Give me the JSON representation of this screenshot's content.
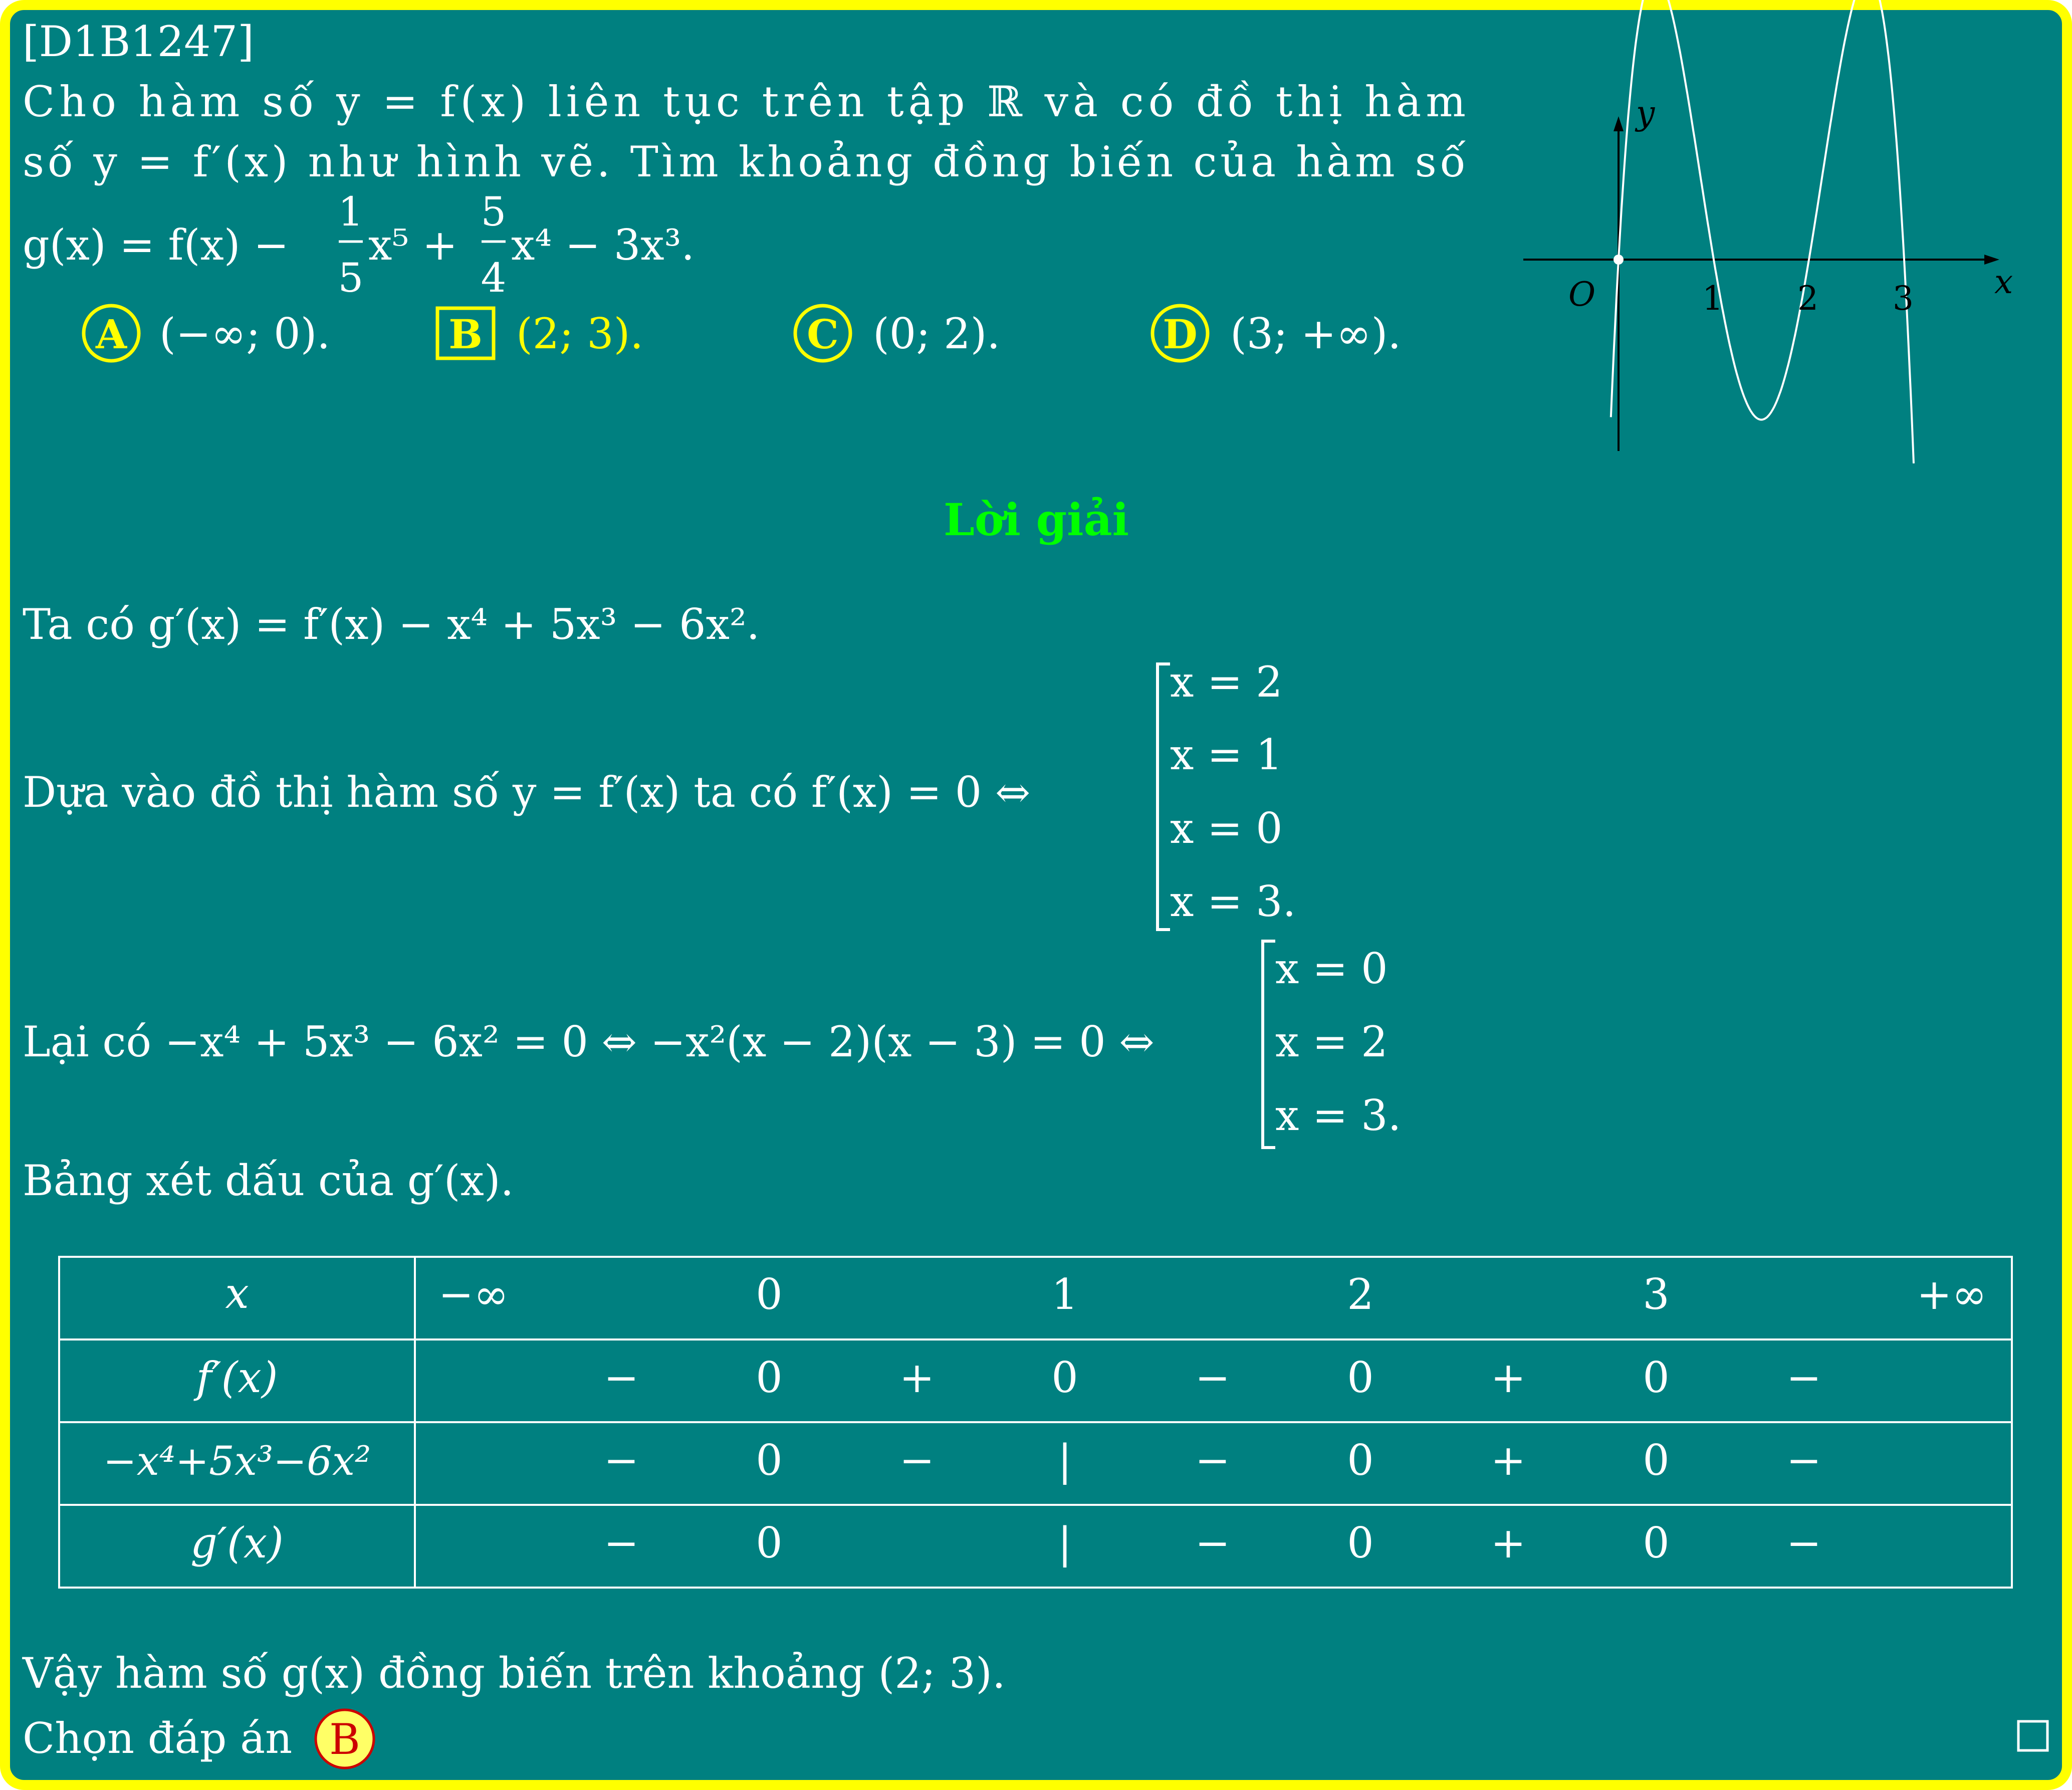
{
  "problem": {
    "id": "[D1B1247]",
    "text_line1": "Cho hàm số y = f(x) liên tục trên tập ℝ và có đồ thị hàm",
    "text_line2": "số y = f′(x) như hình vẽ. Tìm khoảng đồng biến của hàm số",
    "formula_head": "g(x) = f(x) −",
    "frac1": {
      "num": "1",
      "den": "5"
    },
    "term1": "x⁵ +",
    "frac2": {
      "num": "5",
      "den": "4"
    },
    "term2": "x⁴ − 3x³."
  },
  "options": [
    {
      "letter": "A",
      "text": "(−∞; 0).",
      "correct": false
    },
    {
      "letter": "B",
      "text": "(2; 3).",
      "correct": true
    },
    {
      "letter": "C",
      "text": "(0; 2).",
      "correct": false
    },
    {
      "letter": "D",
      "text": "(3; +∞).",
      "correct": false
    }
  ],
  "graph": {
    "x_label": "x",
    "y_label": "y",
    "origin_label": "O",
    "ticks": [
      "1",
      "2",
      "3"
    ]
  },
  "solution": {
    "heading": "Lời giải",
    "line1": "Ta có g′(x) = f′(x) − x⁴ + 5x³ − 6x².",
    "line2": "Dựa vào đồ thị hàm số y = f′(x) ta có f′(x) = 0 ⇔",
    "cases1": [
      "x = 2",
      "x = 1",
      "x = 0",
      "x = 3."
    ],
    "line3": "Lại có −x⁴ + 5x³ − 6x² = 0 ⇔ −x²(x − 2)(x − 3) = 0 ⇔",
    "cases2": [
      "x = 0",
      "x = 2",
      "x = 3."
    ],
    "line4": "Bảng xét dấu của g′(x).",
    "table": {
      "header": [
        "x",
        "−∞",
        "0",
        "1",
        "2",
        "3",
        "+∞"
      ],
      "rows": [
        {
          "label": "f′(x)",
          "cells": [
            "−",
            "0",
            "+",
            "0",
            "−",
            "0",
            "+",
            "0",
            "−"
          ]
        },
        {
          "label": "−x⁴+5x³−6x²",
          "cells": [
            "−",
            "0",
            "−",
            "|",
            "−",
            "0",
            "+",
            "0",
            "−"
          ]
        },
        {
          "label": "g′(x)",
          "cells": [
            "−",
            "0",
            "",
            "|",
            "−",
            "0",
            "+",
            "0",
            "−"
          ]
        }
      ]
    },
    "conclusion": "Vậy hàm số g(x) đồng biến trên khoảng (2; 3).",
    "choose_label": "Chọn đáp án",
    "choose_answer": "B"
  },
  "colors": {
    "background": "#008080",
    "border": "#ffff00",
    "heading": "#00ff00",
    "text": "#ffffff"
  }
}
